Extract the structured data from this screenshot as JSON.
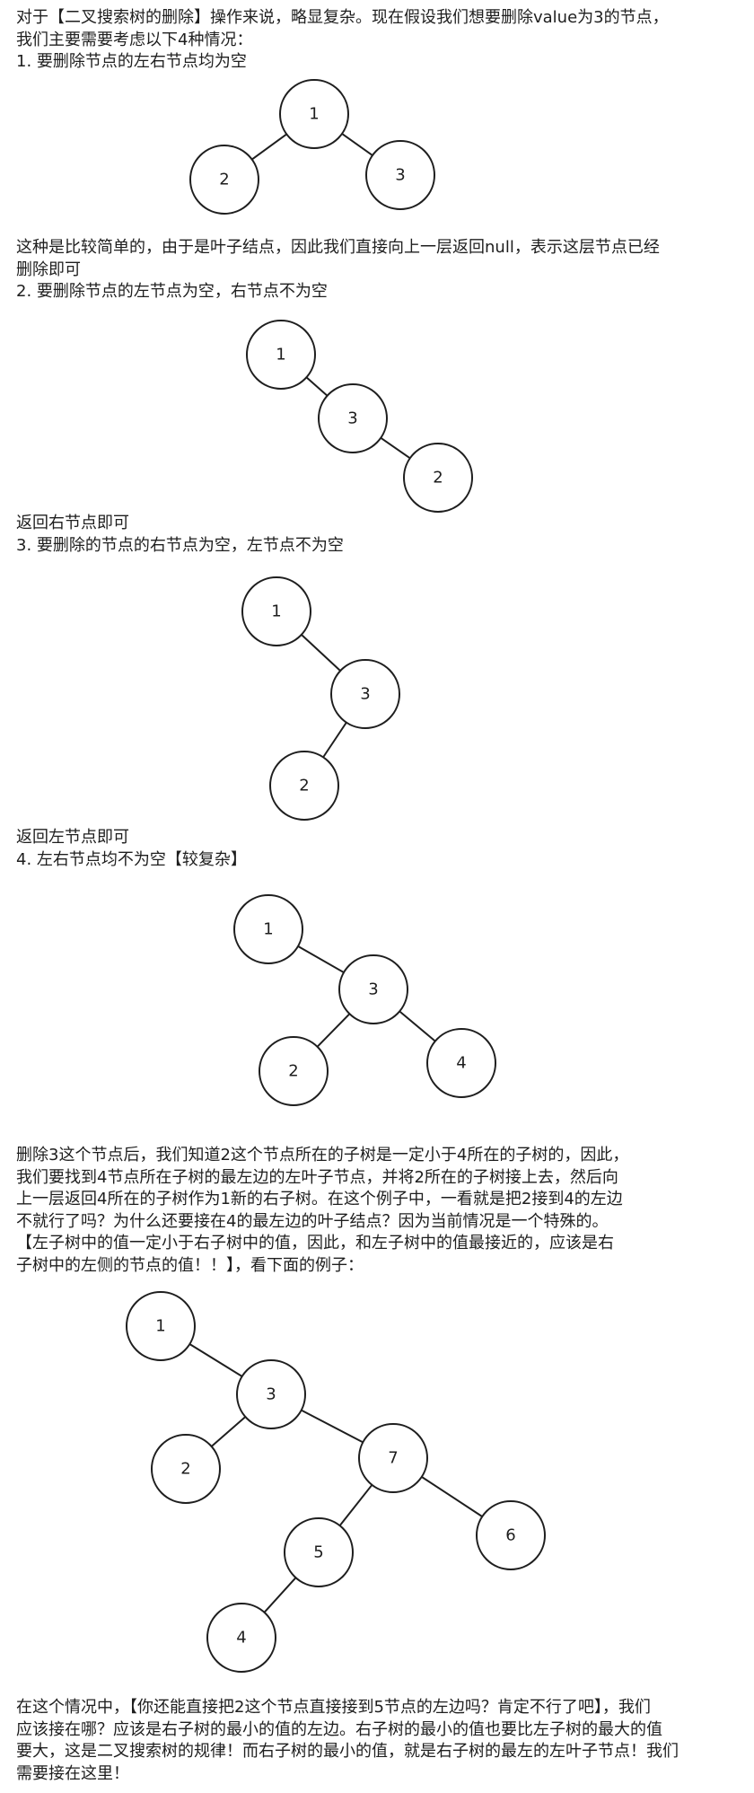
{
  "intro": [
    "对于【二叉搜索树的删除】操作来说，略显复杂。现在假设我们想要删除value为3的节点，",
    "我们主要需要考虑以下4种情况：",
    "1. 要删除节点的左右节点均为空"
  ],
  "case1_text": [
    "这种是比较简单的，由于是叶子结点，因此我们直接向上一层返回null，表示这层节点已经",
    "删除即可",
    "2. 要删除节点的左节点为空，右节点不为空"
  ],
  "case2_text": [
    "返回右节点即可",
    "3. 要删除的节点的右节点为空，左节点不为空"
  ],
  "case3_text": [
    "返回左节点即可",
    "4. 左右节点均不为空【较复杂】"
  ],
  "case4_text": [
    "删除3这个节点后，我们知道2这个节点所在的子树是一定小于4所在的子树的，因此，",
    "我们要找到4节点所在子树的最左边的左叶子节点，并将2所在的子树接上去，然后向",
    "上一层返回4所在的子树作为1新的右子树。在这个例子中，一看就是把2接到4的左边",
    "不就行了吗？为什么还要接在4的最左边的叶子结点？因为当前情况是一个特殊的。",
    "【左子树中的值一定小于右子树中的值，因此，和左子树中的值最接近的，应该是右",
    "子树中的左侧的节点的值！！】，看下面的例子："
  ],
  "final_text": [
    "在这个情况中，【你还能直接把2这个节点直接接到5节点的左边吗？肯定不行了吧】，我们",
    "应该接在哪？应该是右子树的最小的值的左边。右子树的最小的值也要比左子树的最大的值",
    "要大，这是二叉搜索树的规律！而右子树的最小的值，就是右子树的最左的左叶子节点！我们",
    "需要接在这里！"
  ],
  "trees": [
    {
      "nodes": [
        "1",
        "2",
        "3"
      ],
      "edges": [
        [
          "1",
          "2"
        ],
        [
          "1",
          "3"
        ]
      ]
    },
    {
      "nodes": [
        "1",
        "3",
        "2"
      ],
      "edges": [
        [
          "1",
          "3"
        ],
        [
          "3",
          "2"
        ]
      ]
    },
    {
      "nodes": [
        "1",
        "3",
        "2"
      ],
      "edges": [
        [
          "1",
          "3"
        ],
        [
          "3",
          "2"
        ]
      ]
    },
    {
      "nodes": [
        "1",
        "3",
        "2",
        "4"
      ],
      "edges": [
        [
          "1",
          "3"
        ],
        [
          "3",
          "2"
        ],
        [
          "3",
          "4"
        ]
      ]
    },
    {
      "nodes": [
        "1",
        "3",
        "2",
        "7",
        "6",
        "5",
        "4"
      ],
      "edges": [
        [
          "1",
          "3"
        ],
        [
          "3",
          "2"
        ],
        [
          "3",
          "7"
        ],
        [
          "7",
          "5"
        ],
        [
          "7",
          "6"
        ],
        [
          "5",
          "4"
        ]
      ]
    }
  ]
}
